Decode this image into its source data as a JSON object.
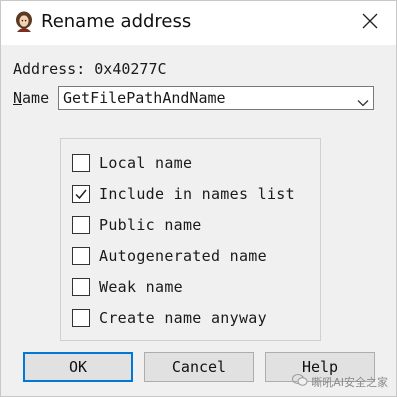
{
  "window": {
    "title": "Rename address",
    "icon": "portrait-icon",
    "close_icon": "close-icon"
  },
  "address": {
    "text": "Address: 0x40277C"
  },
  "name_field": {
    "label": "Name",
    "accelerator": "N",
    "label_rest": "ame",
    "value": "GetFilePathAndName"
  },
  "options": [
    {
      "label": "Local name",
      "checked": false
    },
    {
      "label": "Include in names list",
      "checked": true
    },
    {
      "label": "Public name",
      "checked": false
    },
    {
      "label": "Autogenerated name",
      "checked": false
    },
    {
      "label": "Weak name",
      "checked": false
    },
    {
      "label": "Create name anyway",
      "checked": false
    }
  ],
  "buttons": {
    "ok": "OK",
    "cancel": "Cancel",
    "help": "Help"
  },
  "watermark": {
    "text": "嘶吼AI安全之家",
    "icon": "wechat-icon"
  },
  "colors": {
    "focus_border": "#0078d7",
    "dialog_bg": "#f0f0f0"
  }
}
